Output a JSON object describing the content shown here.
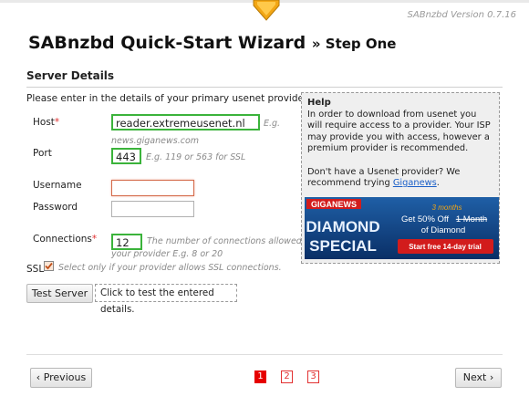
{
  "app": {
    "version": "SABnzbd Version 0.7.16",
    "title": "SABnzbd Quick-Start Wizard",
    "step": "» Step One"
  },
  "colors": {
    "accent": "#f0a010",
    "valid": "#3bb33b",
    "error": "#d46a4a",
    "link": "#1a5fc8",
    "page_active": "#e60000"
  },
  "server": {
    "section_title": "Server Details",
    "intro": "Please enter in the details of your primary usenet provider.",
    "host": {
      "label": "Host",
      "value": "reader.extremeusenet.nl",
      "hint_a": "E.g.",
      "hint_b": "news.giganews.com"
    },
    "port": {
      "label": "Port",
      "value": "443",
      "hint": "E.g. 119 or 563 for SSL"
    },
    "username": {
      "label": "Username",
      "value": ""
    },
    "password": {
      "label": "Password",
      "value": ""
    },
    "connections": {
      "label": "Connections",
      "value": "12",
      "hint_a": "The number of connections allowed by",
      "hint_b": "your provider E.g. 8 or 20"
    },
    "ssl": {
      "label": "SSL",
      "checked": true,
      "hint": "Select only if your provider allows SSL connections."
    },
    "required_mark": "*"
  },
  "test": {
    "button": "Test Server",
    "tip": "Click to test the entered details."
  },
  "help": {
    "title": "Help",
    "body": "In order to download from usenet you will require access to a provider. Your ISP may provide you with access, however a premium provider is recommended.",
    "prompt": "Don't have a Usenet provider? We recommend trying",
    "link": "Giganews",
    "period": ".",
    "banner": {
      "brand": "GIGANEWS",
      "headline1": "DIAMOND",
      "headline2": "SPECIAL",
      "months_new": "3 months",
      "offer_a": "Get 50% Off",
      "offer_strike": "1 Month",
      "offer_b": "of Diamond",
      "cta": "Start free 14-day trial"
    }
  },
  "nav": {
    "previous": "‹ Previous",
    "next": "Next ›",
    "pages": [
      "1",
      "2",
      "3"
    ],
    "current_page": "1"
  }
}
